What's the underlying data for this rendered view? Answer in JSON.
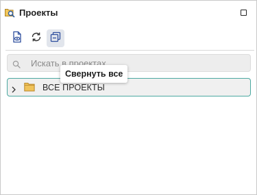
{
  "panel": {
    "title": "Проекты",
    "title_icon": "projects-search-icon"
  },
  "toolbar": {
    "buttons": [
      {
        "icon": "view-file-icon",
        "active": false
      },
      {
        "icon": "refresh-icon",
        "active": false
      },
      {
        "icon": "collapse-all-icon",
        "active": true
      }
    ]
  },
  "tooltip": {
    "text": "Свернуть все"
  },
  "search": {
    "placeholder": "Искать в проектах",
    "value": ""
  },
  "tree": {
    "items": [
      {
        "label": "ВСЕ ПРОЕКТЫ",
        "icon": "folder-icon",
        "expanded": false
      }
    ]
  },
  "colors": {
    "accent_border": "#4aa8a0",
    "active_button_bg": "#e1e5ec",
    "folder": "#e6b64c"
  }
}
